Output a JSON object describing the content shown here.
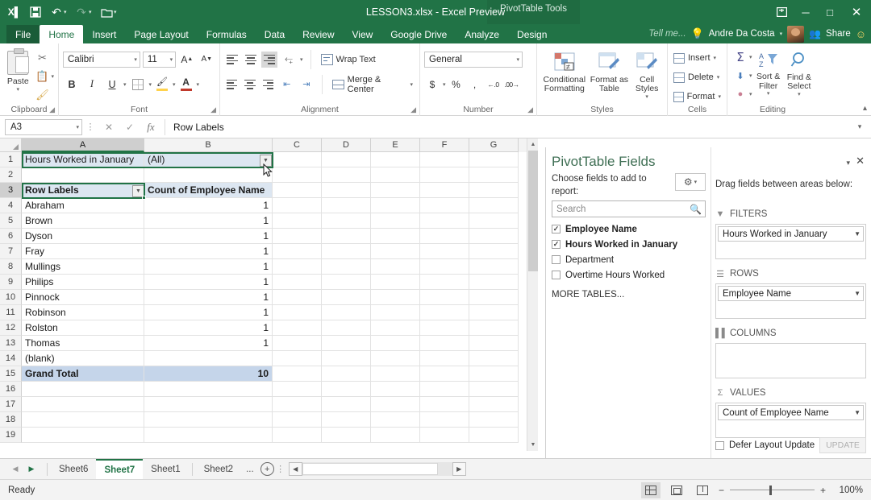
{
  "titlebar": {
    "document_title": "LESSON3.xlsx - Excel Preview",
    "contextual_tools": "PivotTable Tools",
    "qat": [
      {
        "name": "excel-logo-icon",
        "glyph": "X"
      },
      {
        "name": "save-icon",
        "glyph": "ὋE"
      },
      {
        "name": "undo-icon",
        "glyph": "↶"
      },
      {
        "name": "redo-icon",
        "glyph": "↷"
      },
      {
        "name": "open-icon",
        "glyph": "὜1"
      },
      {
        "name": "customize-qat-icon",
        "glyph": "▾"
      }
    ],
    "window_controls": [
      {
        "name": "ribbon-display-options",
        "glyph": "❐"
      },
      {
        "name": "minimize",
        "glyph": "—"
      },
      {
        "name": "restore",
        "glyph": "❐"
      },
      {
        "name": "close",
        "glyph": "✕"
      }
    ]
  },
  "tabs": {
    "items": [
      {
        "label": "File",
        "active": false
      },
      {
        "label": "Home",
        "active": true
      },
      {
        "label": "Insert",
        "active": false
      },
      {
        "label": "Page Layout",
        "active": false
      },
      {
        "label": "Formulas",
        "active": false
      },
      {
        "label": "Data",
        "active": false
      },
      {
        "label": "Review",
        "active": false
      },
      {
        "label": "View",
        "active": false
      },
      {
        "label": "Google Drive",
        "active": false
      },
      {
        "label": "Analyze",
        "active": false
      },
      {
        "label": "Design",
        "active": false
      }
    ],
    "tell_me": "Tell me...",
    "user_name": "Andre Da Costa",
    "share_label": "Share"
  },
  "ribbon": {
    "clipboard": {
      "group_label": "Clipboard",
      "paste_label": "Paste",
      "cut_label": "Cut",
      "copy_label": "Copy",
      "format_painter_label": "Format Painter"
    },
    "font": {
      "group_label": "Font",
      "font_name": "Calibri",
      "font_size": "11",
      "bold": "B",
      "italic": "I",
      "underline": "U",
      "grow_font": "A",
      "shrink_font": "A",
      "fill_color": "A",
      "font_color": "A"
    },
    "alignment": {
      "group_label": "Alignment",
      "wrap_text": "Wrap Text",
      "merge_center": "Merge & Center"
    },
    "number": {
      "group_label": "Number",
      "format": "General",
      "currency": "$",
      "percent": "%",
      "comma": ","
    },
    "styles": {
      "group_label": "Styles",
      "conditional_formatting": "Conditional Formatting",
      "format_as_table": "Format as Table",
      "cell_styles": "Cell Styles"
    },
    "cells": {
      "group_label": "Cells",
      "insert": "Insert",
      "delete": "Delete",
      "format": "Format"
    },
    "editing": {
      "group_label": "Editing",
      "sort_filter": "Sort & Filter",
      "find_select": "Find & Select"
    }
  },
  "formula_bar": {
    "name_box": "A3",
    "formula_value": "Row Labels",
    "cancel_icon": "✕",
    "enter_icon": "✓",
    "function_icon": "fx"
  },
  "grid": {
    "columns": [
      "A",
      "B",
      "C",
      "D",
      "E",
      "F",
      "G"
    ],
    "selected_column": "A",
    "selected_row": 3,
    "rows": [
      {
        "n": "1",
        "a": "Hours Worked in January",
        "b": "(All)",
        "style": "filter"
      },
      {
        "n": "2",
        "a": "",
        "b": "",
        "style": "empty"
      },
      {
        "n": "3",
        "a": "Row Labels",
        "b": "Count of Employee Name",
        "style": "header"
      },
      {
        "n": "4",
        "a": "Abraham",
        "b": "1",
        "style": "data"
      },
      {
        "n": "5",
        "a": "Brown",
        "b": "1",
        "style": "data"
      },
      {
        "n": "6",
        "a": "Dyson",
        "b": "1",
        "style": "data"
      },
      {
        "n": "7",
        "a": "Fray",
        "b": "1",
        "style": "data"
      },
      {
        "n": "8",
        "a": "Mullings",
        "b": "1",
        "style": "data"
      },
      {
        "n": "9",
        "a": "Philips",
        "b": "1",
        "style": "data"
      },
      {
        "n": "10",
        "a": "Pinnock",
        "b": "1",
        "style": "data"
      },
      {
        "n": "11",
        "a": "Robinson",
        "b": "1",
        "style": "data"
      },
      {
        "n": "12",
        "a": "Rolston",
        "b": "1",
        "style": "data"
      },
      {
        "n": "13",
        "a": "Thomas",
        "b": "1",
        "style": "data"
      },
      {
        "n": "14",
        "a": "(blank)",
        "b": "",
        "style": "data"
      },
      {
        "n": "15",
        "a": "Grand Total",
        "b": "10",
        "style": "total"
      },
      {
        "n": "16",
        "a": "",
        "b": "",
        "style": "empty"
      },
      {
        "n": "17",
        "a": "",
        "b": "",
        "style": "empty"
      },
      {
        "n": "18",
        "a": "",
        "b": "",
        "style": "empty"
      },
      {
        "n": "19",
        "a": "",
        "b": "",
        "style": "empty"
      }
    ]
  },
  "pivot_panel": {
    "title": "PivotTable Fields",
    "choose_fields_label": "Choose fields to add to report:",
    "search_placeholder": "Search",
    "fields": [
      {
        "label": "Employee Name",
        "checked": true
      },
      {
        "label": "Hours Worked in January",
        "checked": true
      },
      {
        "label": "Department",
        "checked": false
      },
      {
        "label": "Overtime Hours Worked",
        "checked": false
      }
    ],
    "more_tables": "MORE TABLES...",
    "drag_label": "Drag fields between areas below:",
    "areas": [
      {
        "name": "FILTERS",
        "chip": "Hours Worked in January"
      },
      {
        "name": "ROWS",
        "chip": "Employee Name"
      },
      {
        "name": "COLUMNS",
        "chip": ""
      },
      {
        "name": "VALUES",
        "chip": "Count of Employee Name"
      }
    ],
    "defer_label": "Defer Layout Update",
    "update_label": "UPDATE"
  },
  "sheet_tabs": {
    "items": [
      {
        "label": "Sheet6",
        "active": false
      },
      {
        "label": "Sheet7",
        "active": true
      },
      {
        "label": "Sheet1",
        "active": false
      },
      {
        "label": "Sheet2",
        "active": false
      }
    ],
    "overflow": "...",
    "new_sheet": "+"
  },
  "status_bar": {
    "status": "Ready",
    "zoom": "100%",
    "views": [
      "normal-view",
      "page-layout-view",
      "page-break-view"
    ]
  },
  "colors": {
    "excel_green": "#217346",
    "context_green": "#1f6b41",
    "pivot_blue": "#dce6f1",
    "total_blue": "#c5d5ea"
  }
}
